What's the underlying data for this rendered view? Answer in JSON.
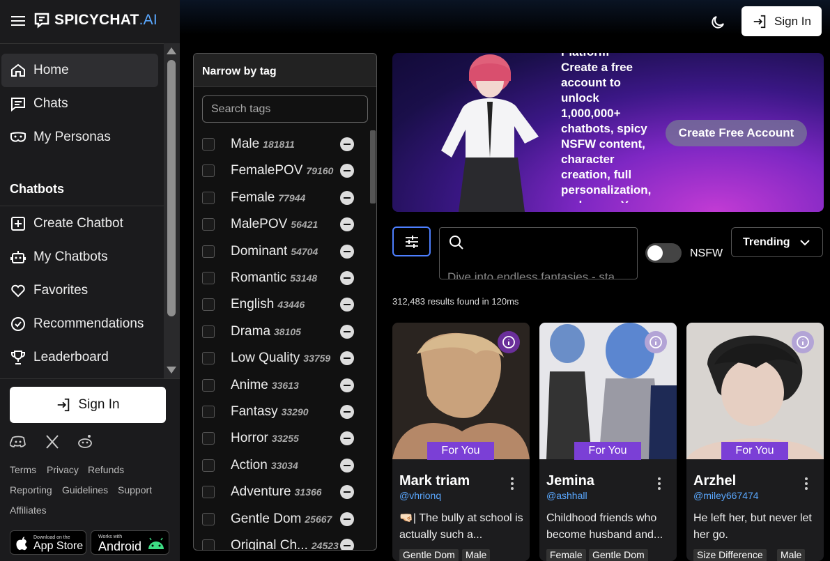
{
  "brand": {
    "name": "SPICYCHAT",
    "suffix": ".AI"
  },
  "nav": {
    "items": [
      {
        "label": "Home",
        "icon": "home-icon"
      },
      {
        "label": "Chats",
        "icon": "chat-icon"
      },
      {
        "label": "My Personas",
        "icon": "persona-icon"
      }
    ],
    "section_title": "Chatbots",
    "chatbot_items": [
      {
        "label": "Create Chatbot",
        "icon": "plus-square-icon"
      },
      {
        "label": "My Chatbots",
        "icon": "bot-icon"
      },
      {
        "label": "Favorites",
        "icon": "heart-icon"
      },
      {
        "label": "Recommendations",
        "icon": "check-circle-icon"
      },
      {
        "label": "Leaderboard",
        "icon": "trophy-icon"
      }
    ]
  },
  "sidebar_signin": "Sign In",
  "footer_links": [
    "Terms",
    "Privacy",
    "Refunds",
    "Reporting",
    "Guidelines",
    "Support",
    "Affiliates"
  ],
  "stores": {
    "apple_small": "Download on the",
    "apple_big": "App Store",
    "android_small": "Works with",
    "android_big": "Android"
  },
  "header": {
    "signin": "Sign In"
  },
  "tag_panel": {
    "title": "Narrow by tag",
    "search_placeholder": "Search tags",
    "tags": [
      {
        "name": "Male",
        "count": "181811"
      },
      {
        "name": "FemalePOV",
        "count": "79160"
      },
      {
        "name": "Female",
        "count": "77944"
      },
      {
        "name": "MalePOV",
        "count": "56421"
      },
      {
        "name": "Dominant",
        "count": "54704"
      },
      {
        "name": "Romantic",
        "count": "53148"
      },
      {
        "name": "English",
        "count": "43446"
      },
      {
        "name": "Drama",
        "count": "38105"
      },
      {
        "name": "Low Quality",
        "count": "33759"
      },
      {
        "name": "Anime",
        "count": "33613"
      },
      {
        "name": "Fantasy",
        "count": "33290"
      },
      {
        "name": "Horror",
        "count": "33255"
      },
      {
        "name": "Action",
        "count": "33034"
      },
      {
        "name": "Adventure",
        "count": "31366"
      },
      {
        "name": "Gentle Dom",
        "count": "25667"
      },
      {
        "name": "Original Ch...",
        "count": "24523"
      }
    ]
  },
  "banner": {
    "cut_heading": "Platform",
    "text": "Create a free account to unlock 1,000,000+ chatbots, spicy NSFW content, character creation, full personalization, and more. You",
    "cta": "Create Free Account"
  },
  "search": {
    "placeholder": "Dive into endless fantasies - sta"
  },
  "nsfw_label": "NSFW",
  "nsfw_enabled": false,
  "sort": {
    "selected": "Trending"
  },
  "results_text": "312,483 results found in 120ms",
  "cards": [
    {
      "badge": "For You",
      "name": "Mark triam",
      "handle": "@vhrionq",
      "desc": "🤜🏻| The bully at school is actually such a...",
      "tags": [
        "Gentle Dom",
        "Male"
      ]
    },
    {
      "badge": "For You",
      "name": "Jemina",
      "handle": "@ashhall",
      "desc": "Childhood friends who become husband and...",
      "tags": [
        "Female",
        "Gentle Dom"
      ]
    },
    {
      "badge": "For You",
      "name": "Arzhel",
      "handle": "@miley667474",
      "desc": "He left her, but never let her go.",
      "tags": [
        "Size Difference",
        "Male"
      ]
    }
  ]
}
